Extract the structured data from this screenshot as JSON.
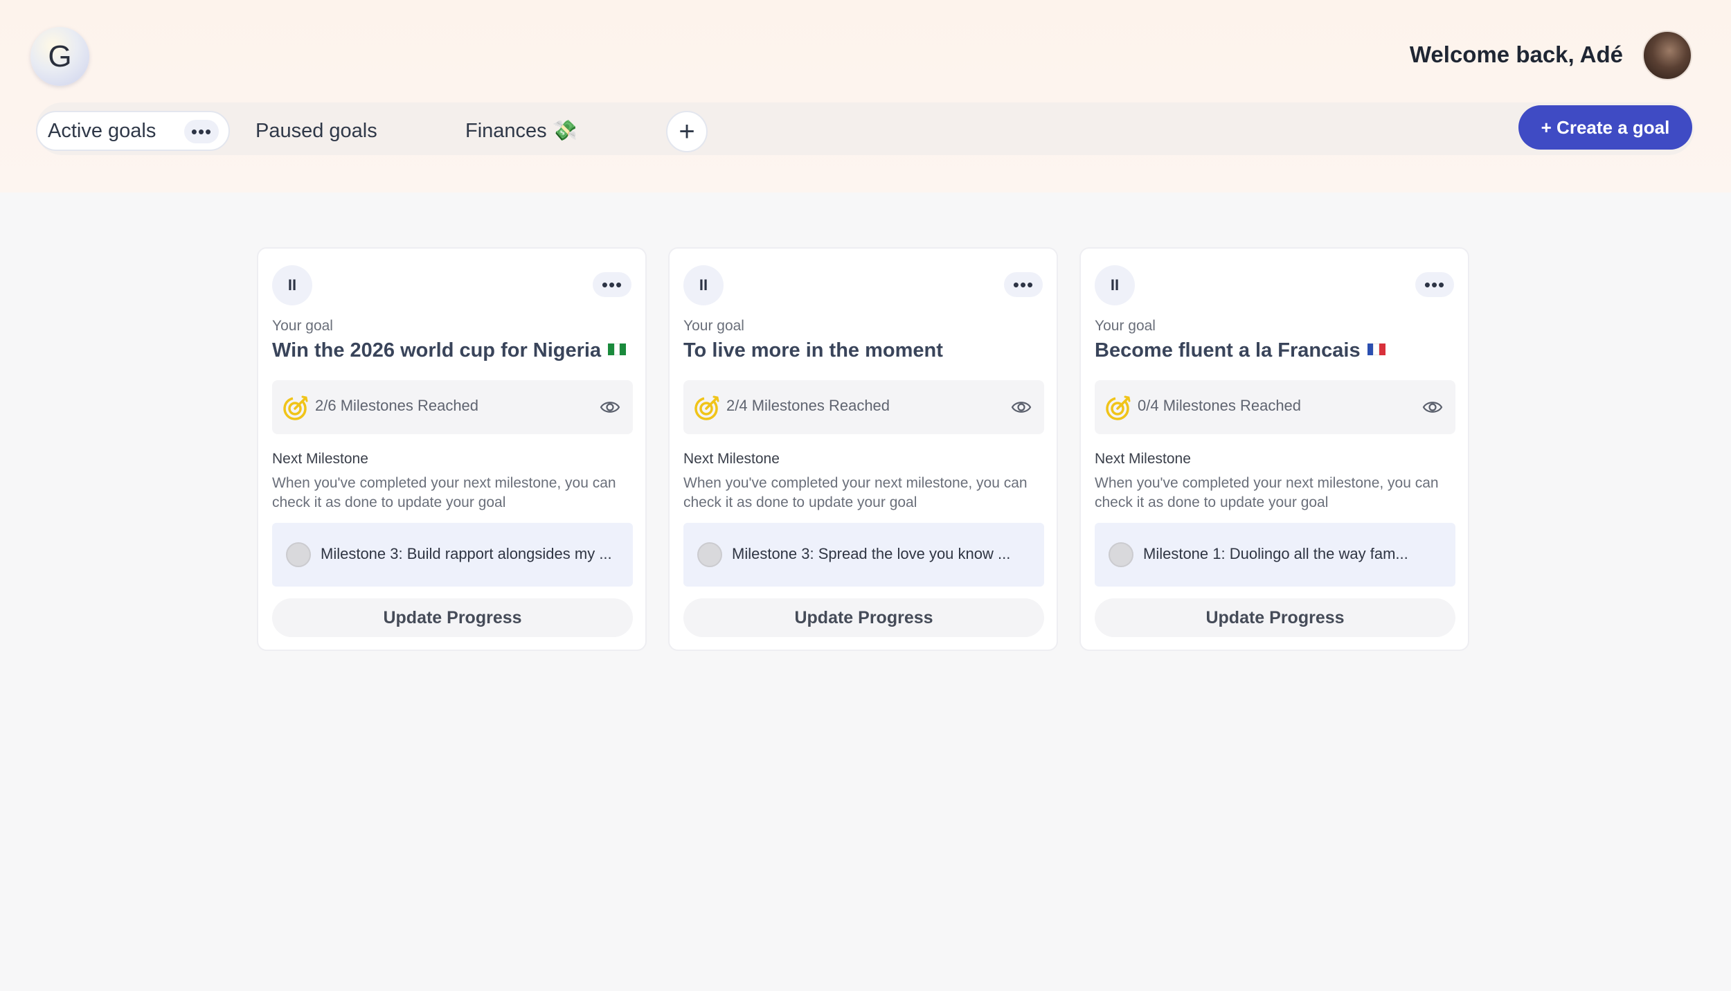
{
  "header": {
    "logo_letter": "G",
    "welcome": "Welcome back, Adé"
  },
  "tabs": [
    {
      "label": "Active goals",
      "active": true
    },
    {
      "label": "Paused goals",
      "active": false
    },
    {
      "label": "Finances 💸",
      "active": false
    }
  ],
  "tab_more": "•••",
  "add_tab_icon": "+",
  "create_button": "+ Create a goal",
  "cards": [
    {
      "pause": "II",
      "more": "•••",
      "caption": "Your goal",
      "title": "Win the 2026 world cup for Nigeria",
      "flag": "nigeria-flag",
      "flag_colors": [
        "#1a8a3c",
        "#ffffff",
        "#1a8a3c"
      ],
      "milestones_reached": "2/6 Milestones Reached",
      "next_label": "Next Milestone",
      "next_desc": "When you've completed your next milestone, you can check it as done to update your goal",
      "next_milestone": "Milestone 3: Build rapport alongsides my ...",
      "update_label": "Update Progress"
    },
    {
      "pause": "II",
      "more": "•••",
      "caption": "Your goal",
      "title": "To live more in the moment",
      "flag": "",
      "milestones_reached": "2/4 Milestones Reached",
      "next_label": "Next Milestone",
      "next_desc": "When you've completed your next milestone, you can check it as done to update your goal",
      "next_milestone": "Milestone 3: Spread the love you know ...",
      "update_label": "Update Progress"
    },
    {
      "pause": "II",
      "more": "•••",
      "caption": "Your goal",
      "title": "Become fluent a la Francais",
      "flag": "france-flag",
      "flag_colors": [
        "#2b4fb0",
        "#ffffff",
        "#d8313b"
      ],
      "milestones_reached": "0/4 Milestones Reached",
      "next_label": "Next Milestone",
      "next_desc": "When you've completed your next milestone, you can check it as done to update your goal",
      "next_milestone": "Milestone 1: Duolingo all the way fam...",
      "update_label": "Update Progress"
    }
  ],
  "colors": {
    "accent": "#3f4bc4",
    "target_icon": "#f0c419",
    "header_bg": "#fdf3ec"
  }
}
